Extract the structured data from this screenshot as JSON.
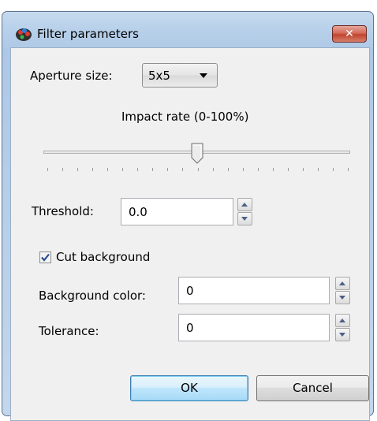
{
  "dialog": {
    "title": "Filter parameters",
    "close_label": "✕"
  },
  "aperture": {
    "label": "Aperture size:",
    "selected": "5x5"
  },
  "impact": {
    "label": "Impact rate (0-100%)",
    "value_percent": 50
  },
  "threshold": {
    "label": "Threshold:",
    "value": "0.0"
  },
  "cut_background": {
    "label": "Cut background",
    "checked": true
  },
  "background_color": {
    "label": "Background color:",
    "value": "0"
  },
  "tolerance": {
    "label": "Tolerance:",
    "value": "0"
  },
  "buttons": {
    "ok": "OK",
    "cancel": "Cancel"
  },
  "icons": {
    "window": "palette-icon",
    "close": "close-icon",
    "dropdown": "chevron-down-icon",
    "spin_up": "arrow-up-icon",
    "spin_down": "arrow-down-icon",
    "check": "checkmark-icon"
  },
  "colors": {
    "title_bar": "#b9d1ea",
    "client_bg": "#f0f0f0",
    "close_button": "#c7503d",
    "default_button_border": "#3c7fb1"
  }
}
